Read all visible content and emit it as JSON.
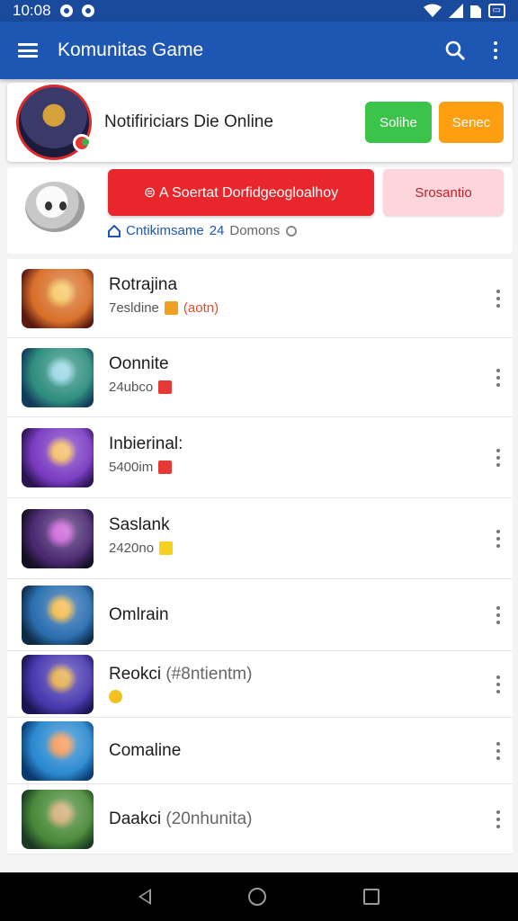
{
  "status_bar": {
    "time": "10:08",
    "battery": "▭"
  },
  "app_bar": {
    "title": "Komunitas Game",
    "icons": [
      "menu-icon",
      "search-icon",
      "more-vert-icon"
    ]
  },
  "profile": {
    "name": "Notifiriciars Die Online",
    "primary_button": "Solihe",
    "secondary_button": "Senec"
  },
  "community": {
    "primary_button": "⊜ A Soertat Dorfidgeogloalhoy",
    "secondary_button": "Srosantio",
    "meta_link": "Cntikimsame",
    "meta_count": "24",
    "meta_suffix": "Domons"
  },
  "games": [
    {
      "name": "Rotrajina",
      "subtitle": "7esldine",
      "extra": "(aotn)",
      "thumb_colors": [
        "#5a1a12",
        "#d8702a",
        "#f3c04d"
      ],
      "tag_color": "#f0a020"
    },
    {
      "name": "Oonnite",
      "subtitle": "24ubco",
      "extra": "",
      "thumb_colors": [
        "#123a5a",
        "#2f8f7f",
        "#88d0e0"
      ],
      "tag_color": "#e53935"
    },
    {
      "name": "Inbierinal:",
      "subtitle": "5400im",
      "extra": "",
      "thumb_colors": [
        "#2a1550",
        "#7b3cc2",
        "#f1b34b"
      ],
      "tag_color": "#e53935"
    },
    {
      "name": "Saslank",
      "subtitle": "2420no",
      "extra": "",
      "thumb_colors": [
        "#140f22",
        "#4c2a72",
        "#c24bd2"
      ],
      "tag_color": "#f5d020"
    },
    {
      "name": "Omlrain",
      "subtitle": "",
      "extra": "",
      "thumb_colors": [
        "#0f2a45",
        "#2b6fb0",
        "#f0b030"
      ],
      "tag_color": ""
    },
    {
      "name": "Reokci",
      "subtitle": "",
      "extra": "(#8ntientm)",
      "thumb_colors": [
        "#1a1550",
        "#4a3ab0",
        "#e0a030"
      ],
      "tag_color": "#f5c020"
    },
    {
      "name": "Comaline",
      "subtitle": "",
      "extra": "",
      "thumb_colors": [
        "#0a3a70",
        "#2c8ad0",
        "#f08a40"
      ],
      "tag_color": ""
    },
    {
      "name": "Daakci",
      "subtitle": "",
      "extra": "(20nhunita)",
      "thumb_colors": [
        "#1c3a22",
        "#4a8a3a",
        "#c8a060"
      ],
      "tag_color": ""
    }
  ],
  "colors": {
    "primary": "#1e56b4",
    "status_bar": "#1a4a9c",
    "green": "#3cc34a",
    "orange": "#ff9f0f",
    "red": "#e8262b",
    "pink": "#fdd5db"
  },
  "nav_bar": [
    "back-icon",
    "home-icon",
    "recents-icon"
  ]
}
